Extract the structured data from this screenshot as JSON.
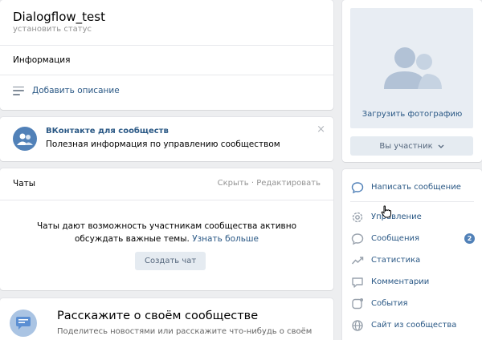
{
  "header": {
    "title": "Dialogflow_test",
    "status": "установить статус",
    "info_label": "Информация",
    "add_description": "Добавить описание"
  },
  "vk_promo": {
    "title": "ВКонтакте для сообществ",
    "text": "Полезная информация по управлению сообществом",
    "close": "×"
  },
  "chats": {
    "title": "Чаты",
    "hide": "Скрыть",
    "separator": "·",
    "edit": "Редактировать",
    "desc_line1": "Чаты дают возможность участникам сообщества активно",
    "desc_line2": "обсуждать важные темы.",
    "learn_more": "Узнать больше",
    "create_button": "Создать чат"
  },
  "tell": {
    "title": "Расскажите о своём сообществе",
    "text": "Поделитесь новостями или расскажите что-нибудь о своём"
  },
  "photo": {
    "upload": "Загрузить фотографию",
    "member_button": "Вы участник"
  },
  "menu": {
    "items": [
      {
        "label": "Написать сообщение",
        "icon": "message-icon"
      },
      {
        "label": "Управление",
        "icon": "gear-icon"
      },
      {
        "label": "Сообщения",
        "icon": "chat-bubble-icon",
        "badge": "2"
      },
      {
        "label": "Статистика",
        "icon": "chart-icon"
      },
      {
        "label": "Комментарии",
        "icon": "comment-icon"
      },
      {
        "label": "События",
        "icon": "events-icon"
      },
      {
        "label": "Сайт из сообщества",
        "icon": "globe-icon"
      }
    ]
  },
  "colors": {
    "accent": "#2a5885",
    "button_bg": "#e5ebf1",
    "badge": "#5181b8",
    "page_bg": "#edeef0"
  }
}
